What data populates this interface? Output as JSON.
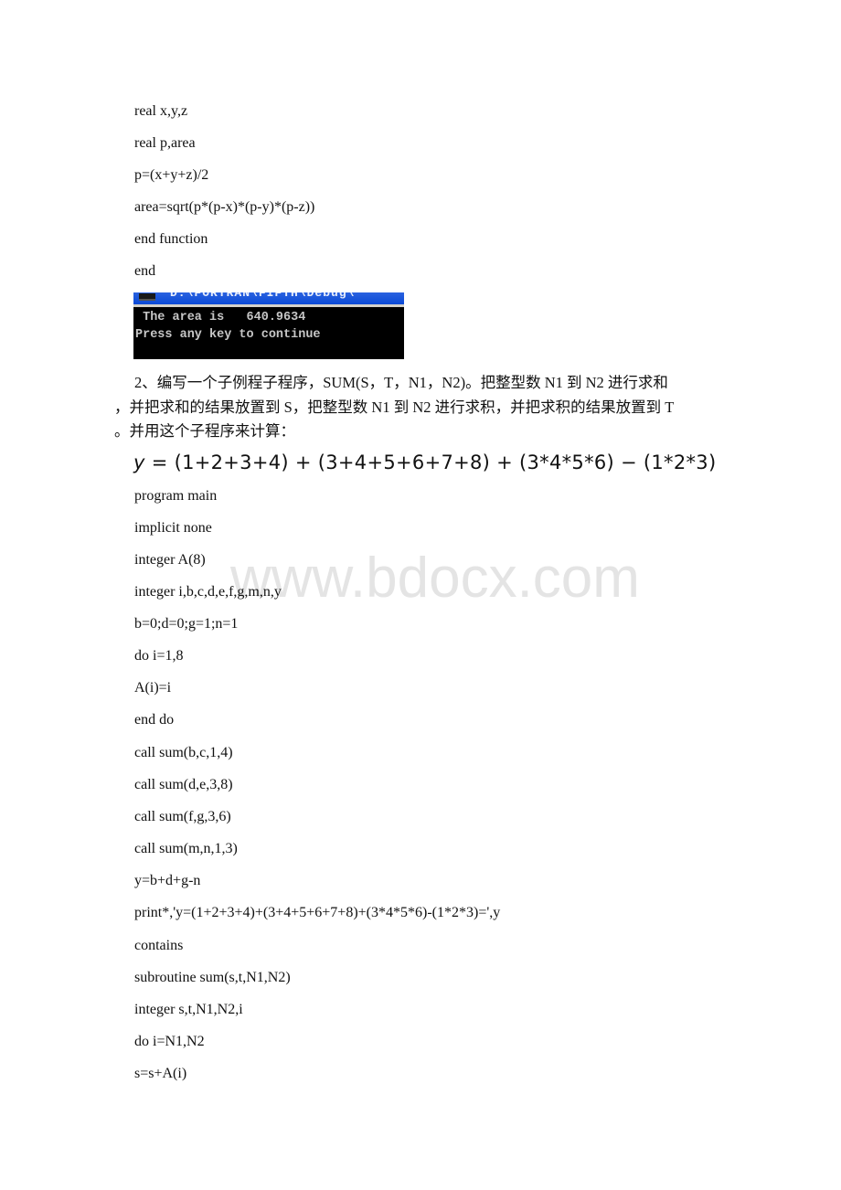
{
  "code_block_1": {
    "lines": [
      " real x,y,z",
      " real p,area",
      " p=(x+y+z)/2",
      " area=sqrt(p*(p-x)*(p-y)*(p-z))",
      " end function",
      "end"
    ]
  },
  "console": {
    "title": "D:\\FORTRAN\\FIFTH\\Debug\\",
    "output_lines": [
      " The area is   640.9634",
      "Press any key to continue"
    ],
    "colors": {
      "titlebar": "#0a49d6",
      "background": "#000000",
      "text": "#c6c6c6"
    }
  },
  "problem": {
    "line1": "2、编写一个子例程子程序，SUM(S，T，N1，N2)。把整型数 N1 到 N2 进行求和",
    "line2": "，并把求和的结果放置到 S，把整型数 N1 到 N2 进行求积，并把求积的结果放置到 T",
    "line3": "。并用这个子程序来计算："
  },
  "formula": {
    "lhs": "y",
    "rhs": " = (1+2+3+4) + (3+4+5+6+7+8) + (3*4*5*6) − (1*2*3)"
  },
  "code_block_2": {
    "lines": [
      "program main",
      " implicit none",
      " integer A(8)",
      " integer i,b,c,d,e,f,g,m,n,y",
      " b=0;d=0;g=1;n=1",
      " do i=1,8",
      " A(i)=i",
      " end do",
      " call sum(b,c,1,4)",
      " call sum(d,e,3,8)",
      " call sum(f,g,3,6)",
      " call sum(m,n,1,3)",
      " y=b+d+g-n",
      " print*,'y=(1+2+3+4)+(3+4+5+6+7+8)+(3*4*5*6)-(1*2*3)=',y",
      " contains",
      " subroutine sum(s,t,N1,N2)",
      " integer s,t,N1,N2,i",
      " do i=N1,N2",
      " s=s+A(i)"
    ]
  },
  "watermark": {
    "text": "www.bdocx.com",
    "color": "#e4e4e4"
  }
}
